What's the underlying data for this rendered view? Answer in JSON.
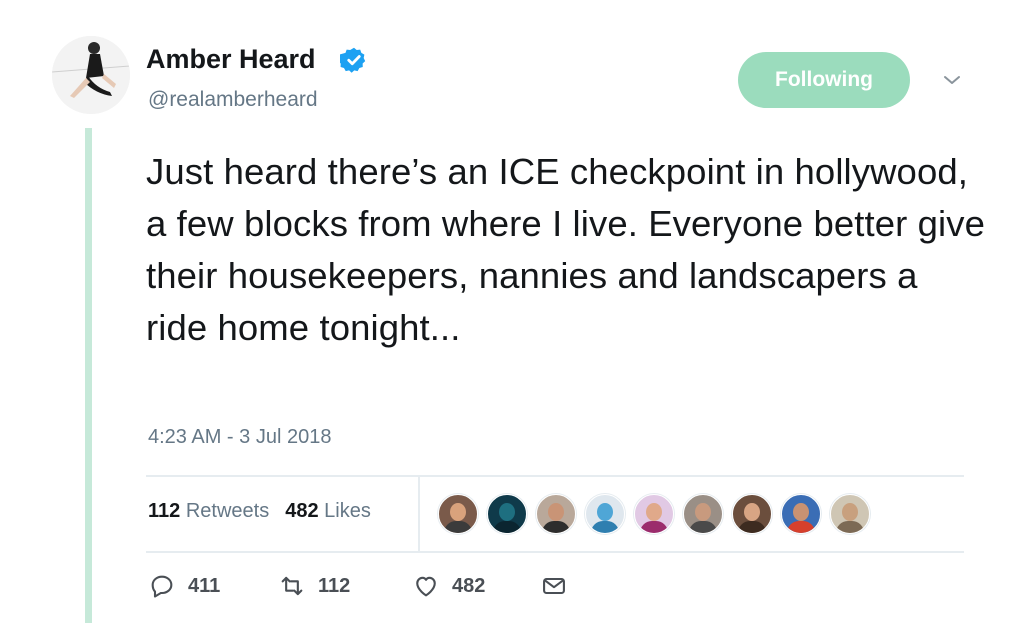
{
  "user": {
    "display_name": "Amber Heard",
    "handle": "@realamberheard",
    "verified_color": "#1da1f2",
    "follow_label": "Following",
    "follow_color": "#9bdcbd"
  },
  "tweet": {
    "text": "Just heard there’s an ICE checkpoint in hollywood, a few blocks from where I live.  Everyone better give their housekeepers, nannies and landscapers a ride home tonight...",
    "timestamp": "4:23 AM - 3 Jul 2018"
  },
  "stats": {
    "retweets_count": "112",
    "retweets_label": "Retweets",
    "likes_count": "482",
    "likes_label": "Likes"
  },
  "likers": [
    {
      "icon": "avatar-1",
      "bg": "#7a5a4a",
      "skin": "#d9a27c",
      "shirt": "#3b3b3b"
    },
    {
      "icon": "avatar-2",
      "bg": "#0f3a4a",
      "skin": "#1e6f80",
      "shirt": "#0b2530"
    },
    {
      "icon": "avatar-3",
      "bg": "#b9a89a",
      "skin": "#c99476",
      "shirt": "#2d2d2d"
    },
    {
      "icon": "avatar-4",
      "bg": "#dfe7ee",
      "skin": "#4fa6d6",
      "shirt": "#2f7fb0"
    },
    {
      "icon": "avatar-5",
      "bg": "#e1c9e4",
      "skin": "#e0a98a",
      "shirt": "#9b2c6c"
    },
    {
      "icon": "avatar-6",
      "bg": "#9a8f86",
      "skin": "#c89a7e",
      "shirt": "#4a4a4a"
    },
    {
      "icon": "avatar-7",
      "bg": "#6b4e3d",
      "skin": "#d8a584",
      "shirt": "#3d2b20"
    },
    {
      "icon": "avatar-8",
      "bg": "#3a6db5",
      "skin": "#c99272",
      "shirt": "#d6402c"
    },
    {
      "icon": "avatar-9",
      "bg": "#cfc6b4",
      "skin": "#c8a07e",
      "shirt": "#7c6a55"
    }
  ],
  "actions": {
    "replies": "411",
    "retweets": "112",
    "likes": "482"
  }
}
